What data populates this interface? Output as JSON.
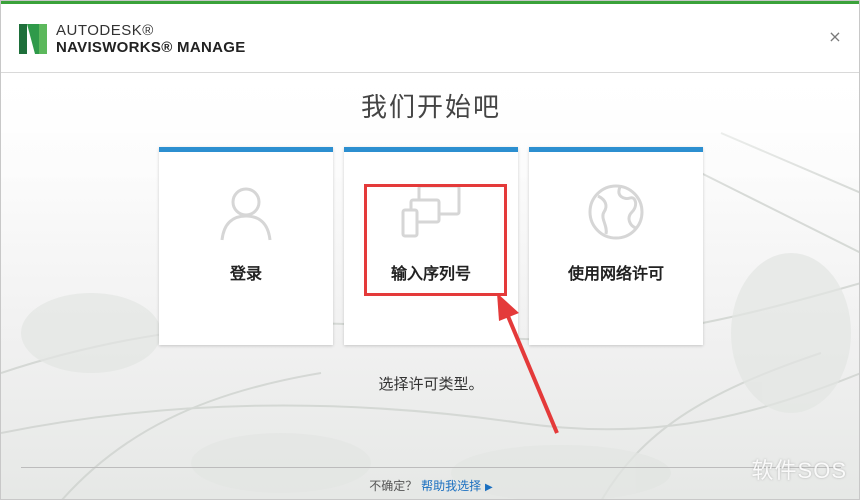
{
  "header": {
    "brand_top": "AUTODESK®",
    "brand_bottom": "NAVISWORKS® MANAGE",
    "logo_icon": "navisworks-n-icon",
    "close_label": "×",
    "accent_color": "#3aa23a"
  },
  "main": {
    "title": "我们开始吧",
    "subtitle": "选择许可类型。",
    "card_accent_color": "#2c8fd0",
    "cards": [
      {
        "label": "登录",
        "icon": "user-icon"
      },
      {
        "label": "输入序列号",
        "icon": "devices-icon"
      },
      {
        "label": "使用网络许可",
        "icon": "globe-icon"
      }
    ]
  },
  "annotation": {
    "highlight_color": "#e43a3a"
  },
  "footer": {
    "question": "不确定？",
    "help_link": "帮助我选择",
    "caret": "▶"
  },
  "watermark": "软件SOS"
}
